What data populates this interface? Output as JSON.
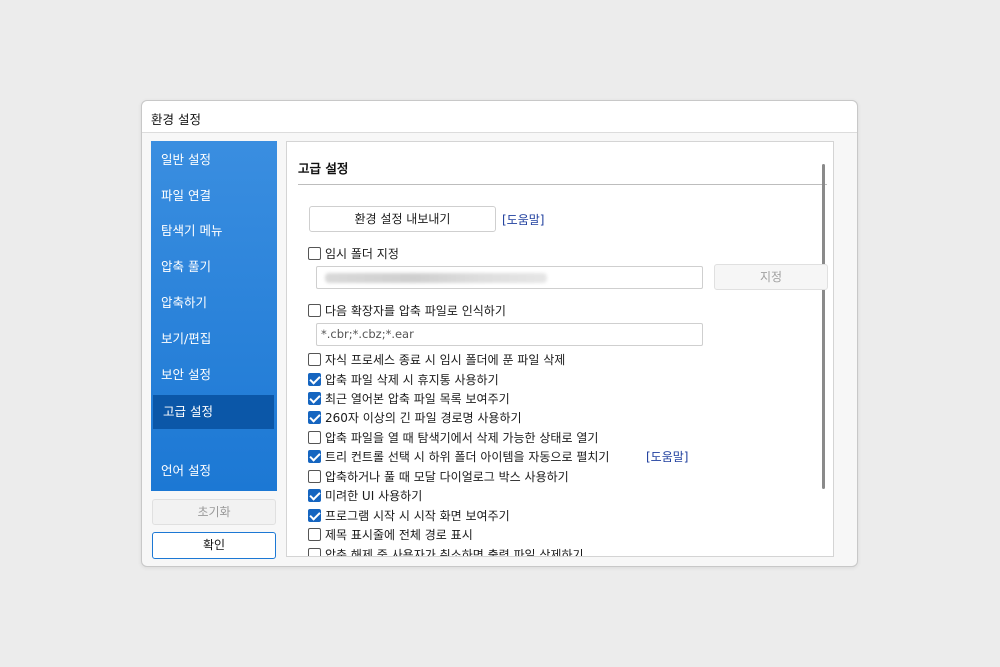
{
  "window": {
    "title": "환경 설정"
  },
  "sidebar": {
    "items": [
      {
        "label": "일반 설정"
      },
      {
        "label": "파일 연결"
      },
      {
        "label": "탐색기 메뉴"
      },
      {
        "label": "압축 풀기"
      },
      {
        "label": "압축하기"
      },
      {
        "label": "보기/편집"
      },
      {
        "label": "보안 설정"
      },
      {
        "label": "고급 설정",
        "selected": true
      },
      {
        "label": "언어 설정"
      }
    ],
    "reset_label": "초기화",
    "ok_label": "확인"
  },
  "panel": {
    "heading": "고급 설정",
    "export_button": "환경 설정 내보내기",
    "help_link": "[도움말]",
    "temp_folder": {
      "label": "임시 폴더 지정",
      "checked": false,
      "value": "",
      "assign_button": "지정"
    },
    "extensions": {
      "label": "다음 확장자를 압축 파일로 인식하기",
      "checked": false,
      "value": "*.cbr;*.cbz;*.ear"
    },
    "options": [
      {
        "label": "자식 프로세스 종료 시 임시 폴더에 푼 파일 삭제",
        "checked": false
      },
      {
        "label": "압축 파일 삭제 시 휴지통 사용하기",
        "checked": true
      },
      {
        "label": "최근 열어본 압축 파일 목록 보여주기",
        "checked": true
      },
      {
        "label": "260자 이상의 긴 파일 경로명 사용하기",
        "checked": true
      },
      {
        "label": "압축 파일을 열 때 탐색기에서 삭제 가능한 상태로 열기",
        "checked": false
      },
      {
        "label": "트리 컨트롤 선택 시 하위 폴더 아이템을 자동으로 펼치기",
        "checked": true,
        "help": "[도움말]"
      },
      {
        "label": "압축하거나 풀 때 모달 다이얼로그 박스 사용하기",
        "checked": false
      },
      {
        "label": "미려한 UI 사용하기",
        "checked": true
      },
      {
        "label": "프로그램 시작 시 시작 화면 보여주기",
        "checked": true
      },
      {
        "label": "제목 표시줄에 전체 경로 표시",
        "checked": false
      },
      {
        "label": "압축 해제 중 사용자가 취소하면 출력 파일 삭제하기",
        "checked": false
      }
    ]
  },
  "colors": {
    "sidebar": "#1c78d4",
    "selected": "#0b57a8",
    "checkbox": "#1565c0",
    "link": "#1f3f9e"
  }
}
